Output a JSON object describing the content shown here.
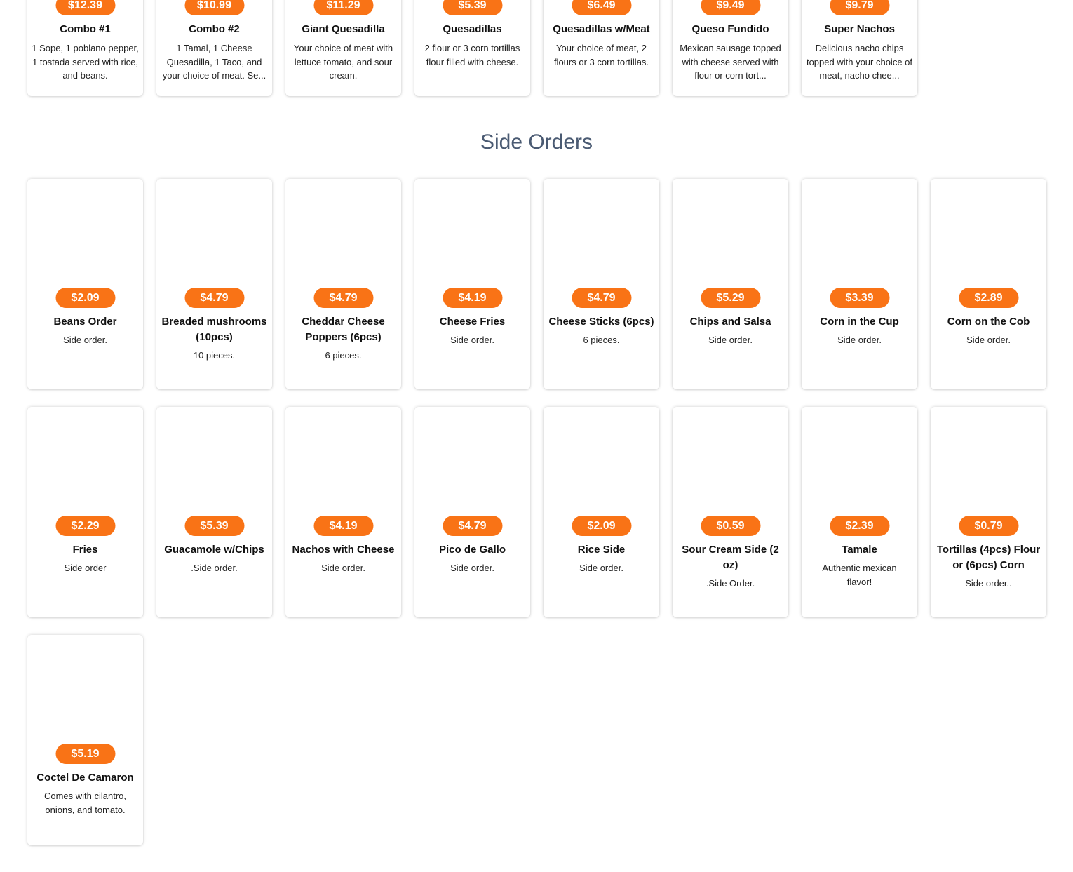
{
  "top_items": [
    {
      "price": "$12.39",
      "name": "Combo #1",
      "description": "1 Sope, 1 poblano pepper, 1 tostada served with rice, and beans."
    },
    {
      "price": "$10.99",
      "name": "Combo #2",
      "description": "1 Tamal, 1 Cheese Quesadilla, 1 Taco, and your choice of meat. Se..."
    },
    {
      "price": "$11.29",
      "name": "Giant Quesadilla",
      "description": "Your choice of meat with lettuce tomato, and sour cream."
    },
    {
      "price": "$5.39",
      "name": "Quesadillas",
      "description": "2 flour or 3 corn tortillas flour filled with cheese."
    },
    {
      "price": "$6.49",
      "name": "Quesadillas w/Meat",
      "description": "Your choice of meat, 2 flours or 3 corn tortillas."
    },
    {
      "price": "$9.49",
      "name": "Queso Fundido",
      "description": "Mexican sausage topped with cheese served with flour or corn tort..."
    },
    {
      "price": "$9.79",
      "name": "Super Nachos",
      "description": "Delicious nacho chips topped with your choice of meat, nacho chee..."
    }
  ],
  "side_orders": {
    "title": "Side Orders",
    "items": [
      {
        "price": "$2.09",
        "name": "Beans Order",
        "description": "Side order."
      },
      {
        "price": "$4.79",
        "name": "Breaded mushrooms (10pcs)",
        "description": "10 pieces."
      },
      {
        "price": "$4.79",
        "name": "Cheddar Cheese Poppers (6pcs)",
        "description": "6 pieces."
      },
      {
        "price": "$4.19",
        "name": "Cheese Fries",
        "description": "Side order."
      },
      {
        "price": "$4.79",
        "name": "Cheese Sticks (6pcs)",
        "description": "6 pieces."
      },
      {
        "price": "$5.29",
        "name": "Chips and Salsa",
        "description": "Side order."
      },
      {
        "price": "$3.39",
        "name": "Corn in the Cup",
        "description": "Side order."
      },
      {
        "price": "$2.89",
        "name": "Corn on the Cob",
        "description": "Side order."
      },
      {
        "price": "$2.29",
        "name": "Fries",
        "description": "Side order"
      },
      {
        "price": "$5.39",
        "name": "Guacamole w/Chips",
        "description": ".Side order."
      },
      {
        "price": "$4.19",
        "name": "Nachos with Cheese",
        "description": "Side order."
      },
      {
        "price": "$4.79",
        "name": "Pico de Gallo",
        "description": "Side order."
      },
      {
        "price": "$2.09",
        "name": "Rice Side",
        "description": "Side order."
      },
      {
        "price": "$0.59",
        "name": "Sour Cream Side (2 oz)",
        "description": ".Side Order."
      },
      {
        "price": "$2.39",
        "name": "Tamale",
        "description": "Authentic mexican flavor!"
      },
      {
        "price": "$0.79",
        "name": "Tortillas (4pcs) Flour or (6pcs) Corn",
        "description": "Side order.."
      },
      {
        "price": "$5.19",
        "name": "Coctel De Camaron",
        "description": "Comes with cilantro, onions, and tomato."
      }
    ]
  },
  "colors": {
    "price_badge": "#f97316",
    "section_title": "#4b5b73"
  }
}
